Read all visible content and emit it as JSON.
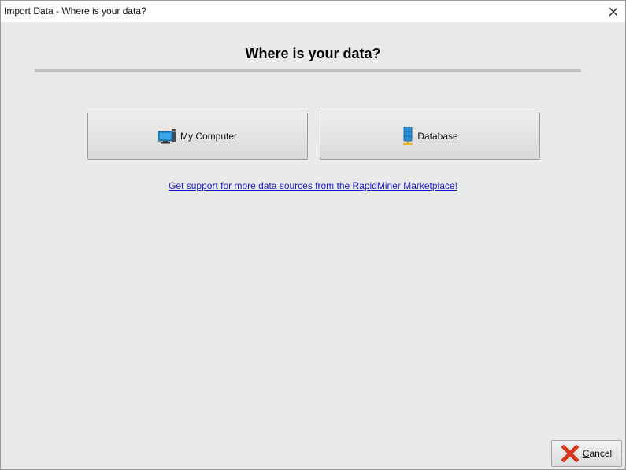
{
  "window": {
    "title": "Import Data - Where is your data?"
  },
  "main": {
    "heading": "Where is your data?",
    "sources": [
      {
        "label": "My Computer",
        "icon": "computer-icon"
      },
      {
        "label": "Database",
        "icon": "database-icon"
      }
    ],
    "marketplace_link": "Get support for more data sources from the RapidMiner Marketplace!"
  },
  "footer": {
    "cancel_label": "Cancel",
    "cancel_icon": "red-x-icon"
  },
  "colors": {
    "dialog_bg": "#e9eaea",
    "link": "#1a1acc",
    "cancel_icon": "#d9381e"
  }
}
